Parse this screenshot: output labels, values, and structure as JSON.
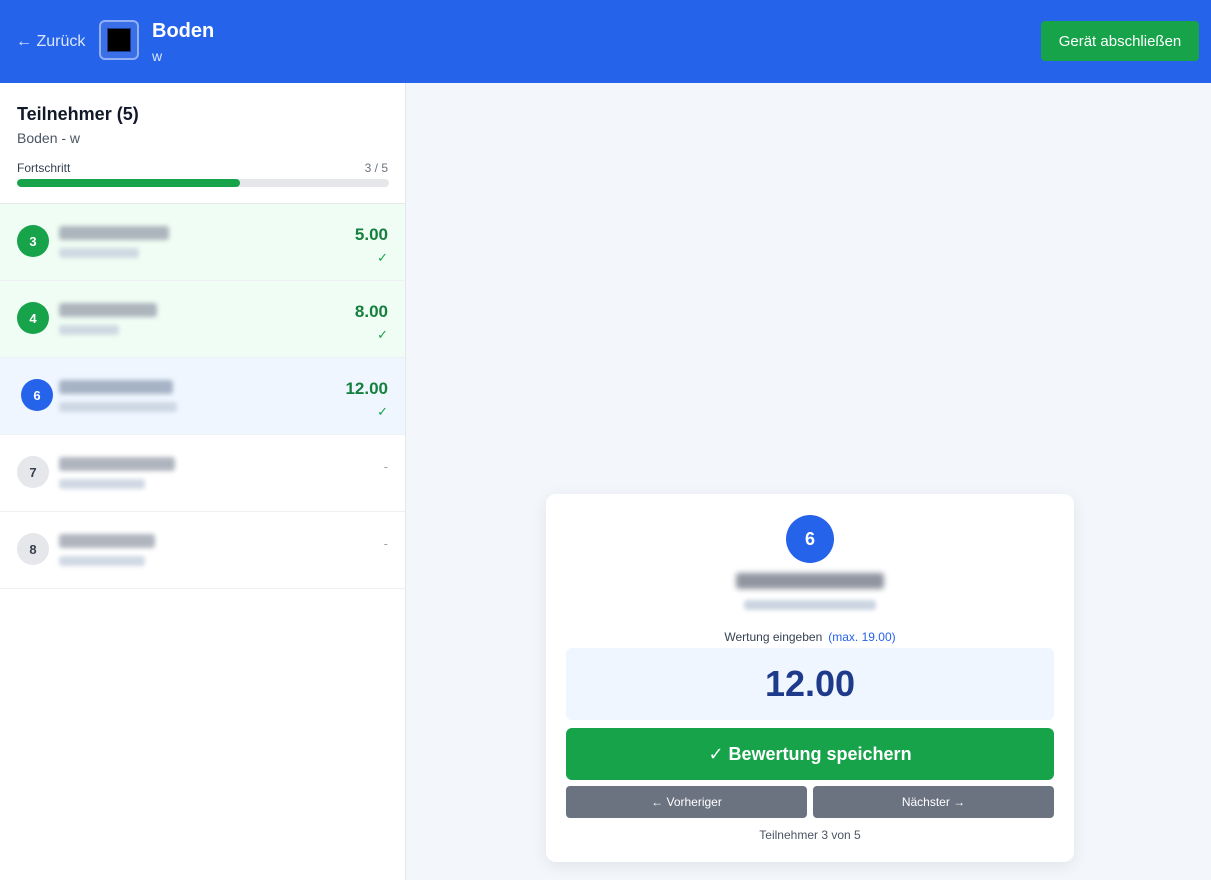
{
  "header": {
    "back_label": "← Zurück",
    "title": "Boden",
    "subtitle": "w",
    "finish_label": "Gerät abschließen",
    "bg_color": "#2563eb"
  },
  "sidebar": {
    "title": "Teilnehmer (5)",
    "subtitle": "Boden - w",
    "progress_label": "Fortschritt",
    "progress_count": "3 / 5",
    "progress_done": 3,
    "progress_total": 5,
    "participants": [
      {
        "number": "3",
        "score": "5.00",
        "check": "✓",
        "status": "done"
      },
      {
        "number": "4",
        "score": "8.00",
        "check": "✓",
        "status": "done"
      },
      {
        "number": "6",
        "score": "12.00",
        "check": "✓",
        "status": "active"
      },
      {
        "number": "7",
        "score": "-",
        "status": "open"
      },
      {
        "number": "8",
        "score": "-",
        "status": "open"
      }
    ]
  },
  "card": {
    "number": "6",
    "score_label": "Wertung eingeben",
    "score_max": "(max. 19.00)",
    "score_value": "12.00",
    "save_label": "✓ Bewertung speichern",
    "prev_label": "← Vorheriger",
    "next_label": "Nächster →",
    "footer": "Teilnehmer 3 von 5"
  },
  "colors": {
    "accent": "#2563eb",
    "success": "#16a34a",
    "score_text": "#15803d"
  }
}
